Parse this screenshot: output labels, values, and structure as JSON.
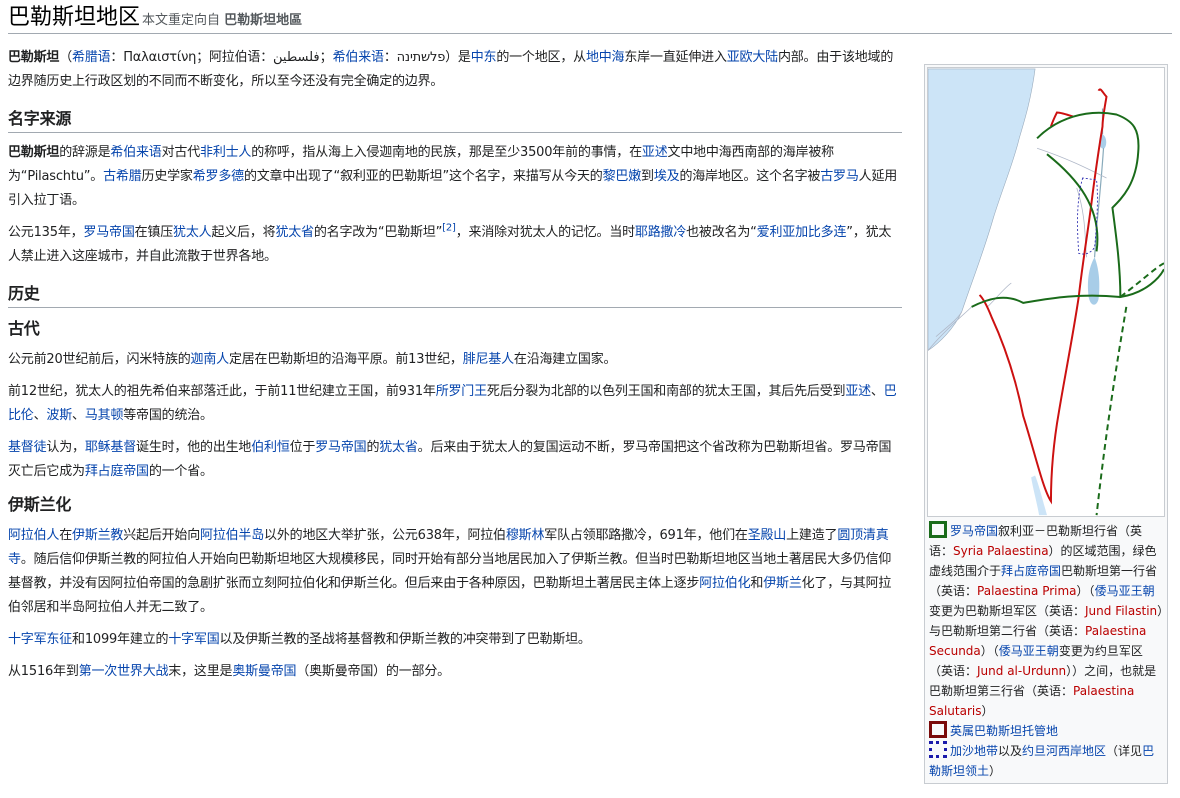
{
  "title": {
    "main": "巴勒斯坦地区",
    "redirect_prefix": "本文重定向自",
    "redirect_target": "巴勒斯坦地區"
  },
  "intro": {
    "p1": [
      {
        "t": "巴勒斯坦",
        "b": true
      },
      {
        "t": "（"
      },
      {
        "t": "希腊语",
        "l": true
      },
      {
        "t": "：Παλαιστίνη；阿拉伯语：فلسطين；"
      },
      {
        "t": "希伯来语",
        "l": true
      },
      {
        "t": "：פלשתינה）是"
      },
      {
        "t": "中东",
        "l": true
      },
      {
        "t": "的一个地区，从"
      },
      {
        "t": "地中海",
        "l": true
      },
      {
        "t": "东岸一直延伸进入"
      },
      {
        "t": "亚欧大陆",
        "l": true
      },
      {
        "t": "内部。由于该地域的边界随历史上行政区划的不同而不断变化，所以至今还没有完全确定的边界。"
      }
    ]
  },
  "sections": [
    {
      "kind": "h2",
      "heading": "名字来源",
      "paras": [
        [
          {
            "t": "巴勒斯坦",
            "b": true
          },
          {
            "t": "的辞源是"
          },
          {
            "t": "希伯来语",
            "l": true
          },
          {
            "t": "对古代"
          },
          {
            "t": "非利士人",
            "l": true
          },
          {
            "t": "的称呼，指从海上入侵迦南地的民族，那是至少3500年前的事情，在"
          },
          {
            "t": "亚述",
            "l": true
          },
          {
            "t": "文中地中海西南部的海岸被称为“Pilaschtu”。"
          },
          {
            "t": "古希腊",
            "l": true
          },
          {
            "t": "历史学家"
          },
          {
            "t": "希罗多德",
            "l": true
          },
          {
            "t": "的文章中出现了“叙利亚的巴勒斯坦”这个名字，来描写从今天的"
          },
          {
            "t": "黎巴嫩",
            "l": true
          },
          {
            "t": "到"
          },
          {
            "t": "埃及",
            "l": true
          },
          {
            "t": "的海岸地区。这个名字被"
          },
          {
            "t": "古罗马",
            "l": true
          },
          {
            "t": "人延用引入拉丁语。"
          }
        ],
        [
          {
            "t": "公元135年，"
          },
          {
            "t": "罗马帝国",
            "l": true
          },
          {
            "t": "在镇压"
          },
          {
            "t": "犹太人",
            "l": true
          },
          {
            "t": "起义后，将"
          },
          {
            "t": "犹太省",
            "l": true
          },
          {
            "t": "的名字改为“巴勒斯坦”"
          },
          {
            "t": "[2]",
            "sup": true
          },
          {
            "t": "，来消除对犹太人的记忆。当时"
          },
          {
            "t": "耶路撒冷",
            "l": true
          },
          {
            "t": "也被改名为“"
          },
          {
            "t": "爱利亚加比多连",
            "l": true
          },
          {
            "t": "”，犹太人禁止进入这座城市，并自此流散于世界各地。"
          }
        ]
      ]
    },
    {
      "kind": "h2",
      "heading": "历史",
      "paras": []
    },
    {
      "kind": "h3",
      "heading": "古代",
      "paras": [
        [
          {
            "t": "公元前20世纪前后，闪米特族的"
          },
          {
            "t": "迦南人",
            "l": true
          },
          {
            "t": "定居在巴勒斯坦的沿海平原。前13世纪，"
          },
          {
            "t": "腓尼基人",
            "l": true
          },
          {
            "t": "在沿海建立国家。"
          }
        ],
        [
          {
            "t": "前12世纪，犹太人的祖先希伯来部落迁此，于前11世纪建立王国，前931年"
          },
          {
            "t": "所罗门王",
            "l": true
          },
          {
            "t": "死后分裂为北部的以色列王国和南部的犹太王国，其后先后受到"
          },
          {
            "t": "亚述",
            "l": true
          },
          {
            "t": "、"
          },
          {
            "t": "巴比伦",
            "l": true
          },
          {
            "t": "、"
          },
          {
            "t": "波斯",
            "l": true
          },
          {
            "t": "、"
          },
          {
            "t": "马其顿",
            "l": true
          },
          {
            "t": "等帝国的统治。"
          }
        ],
        [
          {
            "t": "基督徒",
            "l": true
          },
          {
            "t": "认为，"
          },
          {
            "t": "耶稣基督",
            "l": true
          },
          {
            "t": "诞生时，他的出生地"
          },
          {
            "t": "伯利恒",
            "l": true
          },
          {
            "t": "位于"
          },
          {
            "t": "罗马帝国",
            "l": true
          },
          {
            "t": "的"
          },
          {
            "t": "犹太省",
            "l": true
          },
          {
            "t": "。后来由于犹太人的复国运动不断，罗马帝国把这个省改称为巴勒斯坦省。罗马帝国灭亡后它成为"
          },
          {
            "t": "拜占庭帝国",
            "l": true
          },
          {
            "t": "的一个省。"
          }
        ]
      ]
    },
    {
      "kind": "h3",
      "heading": "伊斯兰化",
      "paras": [
        [
          {
            "t": "阿拉伯人",
            "l": true
          },
          {
            "t": "在"
          },
          {
            "t": "伊斯兰教",
            "l": true
          },
          {
            "t": "兴起后开始向"
          },
          {
            "t": "阿拉伯半岛",
            "l": true
          },
          {
            "t": "以外的地区大举扩张，公元638年，阿拉伯"
          },
          {
            "t": "穆斯林",
            "l": true
          },
          {
            "t": "军队占领耶路撒冷，691年，他们在"
          },
          {
            "t": "圣殿山",
            "l": true
          },
          {
            "t": "上建造了"
          },
          {
            "t": "圆顶清真寺",
            "l": true
          },
          {
            "t": "。随后信仰伊斯兰教的阿拉伯人开始向巴勒斯坦地区大规模移民，同时开始有部分当地居民加入了伊斯兰教。但当时巴勒斯坦地区当地土著居民大多仍信仰基督教，并没有因阿拉伯帝国的急剧扩张而立刻阿拉伯化和伊斯兰化。但后来由于各种原因，巴勒斯坦土著居民主体上逐步"
          },
          {
            "t": "阿拉伯化",
            "l": true
          },
          {
            "t": "和"
          },
          {
            "t": "伊斯兰",
            "l": true
          },
          {
            "t": "化了，与其阿拉伯邻居和半岛阿拉伯人并无二致了。"
          }
        ],
        [
          {
            "t": "十字军东征",
            "l": true
          },
          {
            "t": "和1099年建立的"
          },
          {
            "t": "十字军国",
            "l": true
          },
          {
            "t": "以及伊斯兰教的圣战将基督教和伊斯兰教的冲突带到了巴勒斯坦。"
          }
        ],
        [
          {
            "t": "从1516年到"
          },
          {
            "t": "第一次世界大战",
            "l": true
          },
          {
            "t": "末，这里是"
          },
          {
            "t": "奥斯曼帝国",
            "l": true
          },
          {
            "t": "（奥斯曼帝国）的一部分。"
          }
        ]
      ]
    }
  ],
  "infobox": {
    "colors": {
      "green": "#1a6b1a",
      "red": "#cc1111",
      "sea": "#cce4f7",
      "lake": "#a8cde8"
    },
    "legend": [
      {
        "swatch": "green",
        "runs": [
          {
            "t": "罗马帝国",
            "l": true
          },
          {
            "t": "叙利亚－巴勒斯坦行省（英语："
          },
          {
            "t": "Syria Palaestina",
            "new": true
          },
          {
            "t": "）的区域范围，绿色虚线范围介于"
          },
          {
            "t": "拜占庭帝国",
            "l": true
          },
          {
            "t": "巴勒斯坦第一行省（英语："
          },
          {
            "t": "Palaestina Prima",
            "new": true
          },
          {
            "t": "）（"
          },
          {
            "t": "倭马亚王朝",
            "l": true
          },
          {
            "t": "变更为巴勒斯坦军区（英语："
          },
          {
            "t": "Jund Filastin",
            "new": true
          },
          {
            "t": "）与巴勒斯坦第二行省（英语："
          },
          {
            "t": "Palaestina Secunda",
            "new": true
          },
          {
            "t": "）（"
          },
          {
            "t": "倭马亚王朝",
            "l": true
          },
          {
            "t": "变更为约旦军区（英语："
          },
          {
            "t": "Jund al-Urdunn",
            "new": true
          },
          {
            "t": "））之间，也就是巴勒斯坦第三行省（英语："
          },
          {
            "t": "Palaestina Salutaris",
            "new": true
          },
          {
            "t": "）"
          }
        ]
      },
      {
        "swatch": "red",
        "runs": [
          {
            "t": "英属巴勒斯坦托管地",
            "l": true
          }
        ]
      },
      {
        "swatch": "blue",
        "runs": [
          {
            "t": "加沙地带",
            "l": true
          },
          {
            "t": "以及"
          },
          {
            "t": "约旦河西岸地区",
            "l": true
          },
          {
            "t": "（详见"
          },
          {
            "t": "巴勒斯坦领土",
            "l": true
          },
          {
            "t": "）"
          }
        ]
      }
    ]
  }
}
